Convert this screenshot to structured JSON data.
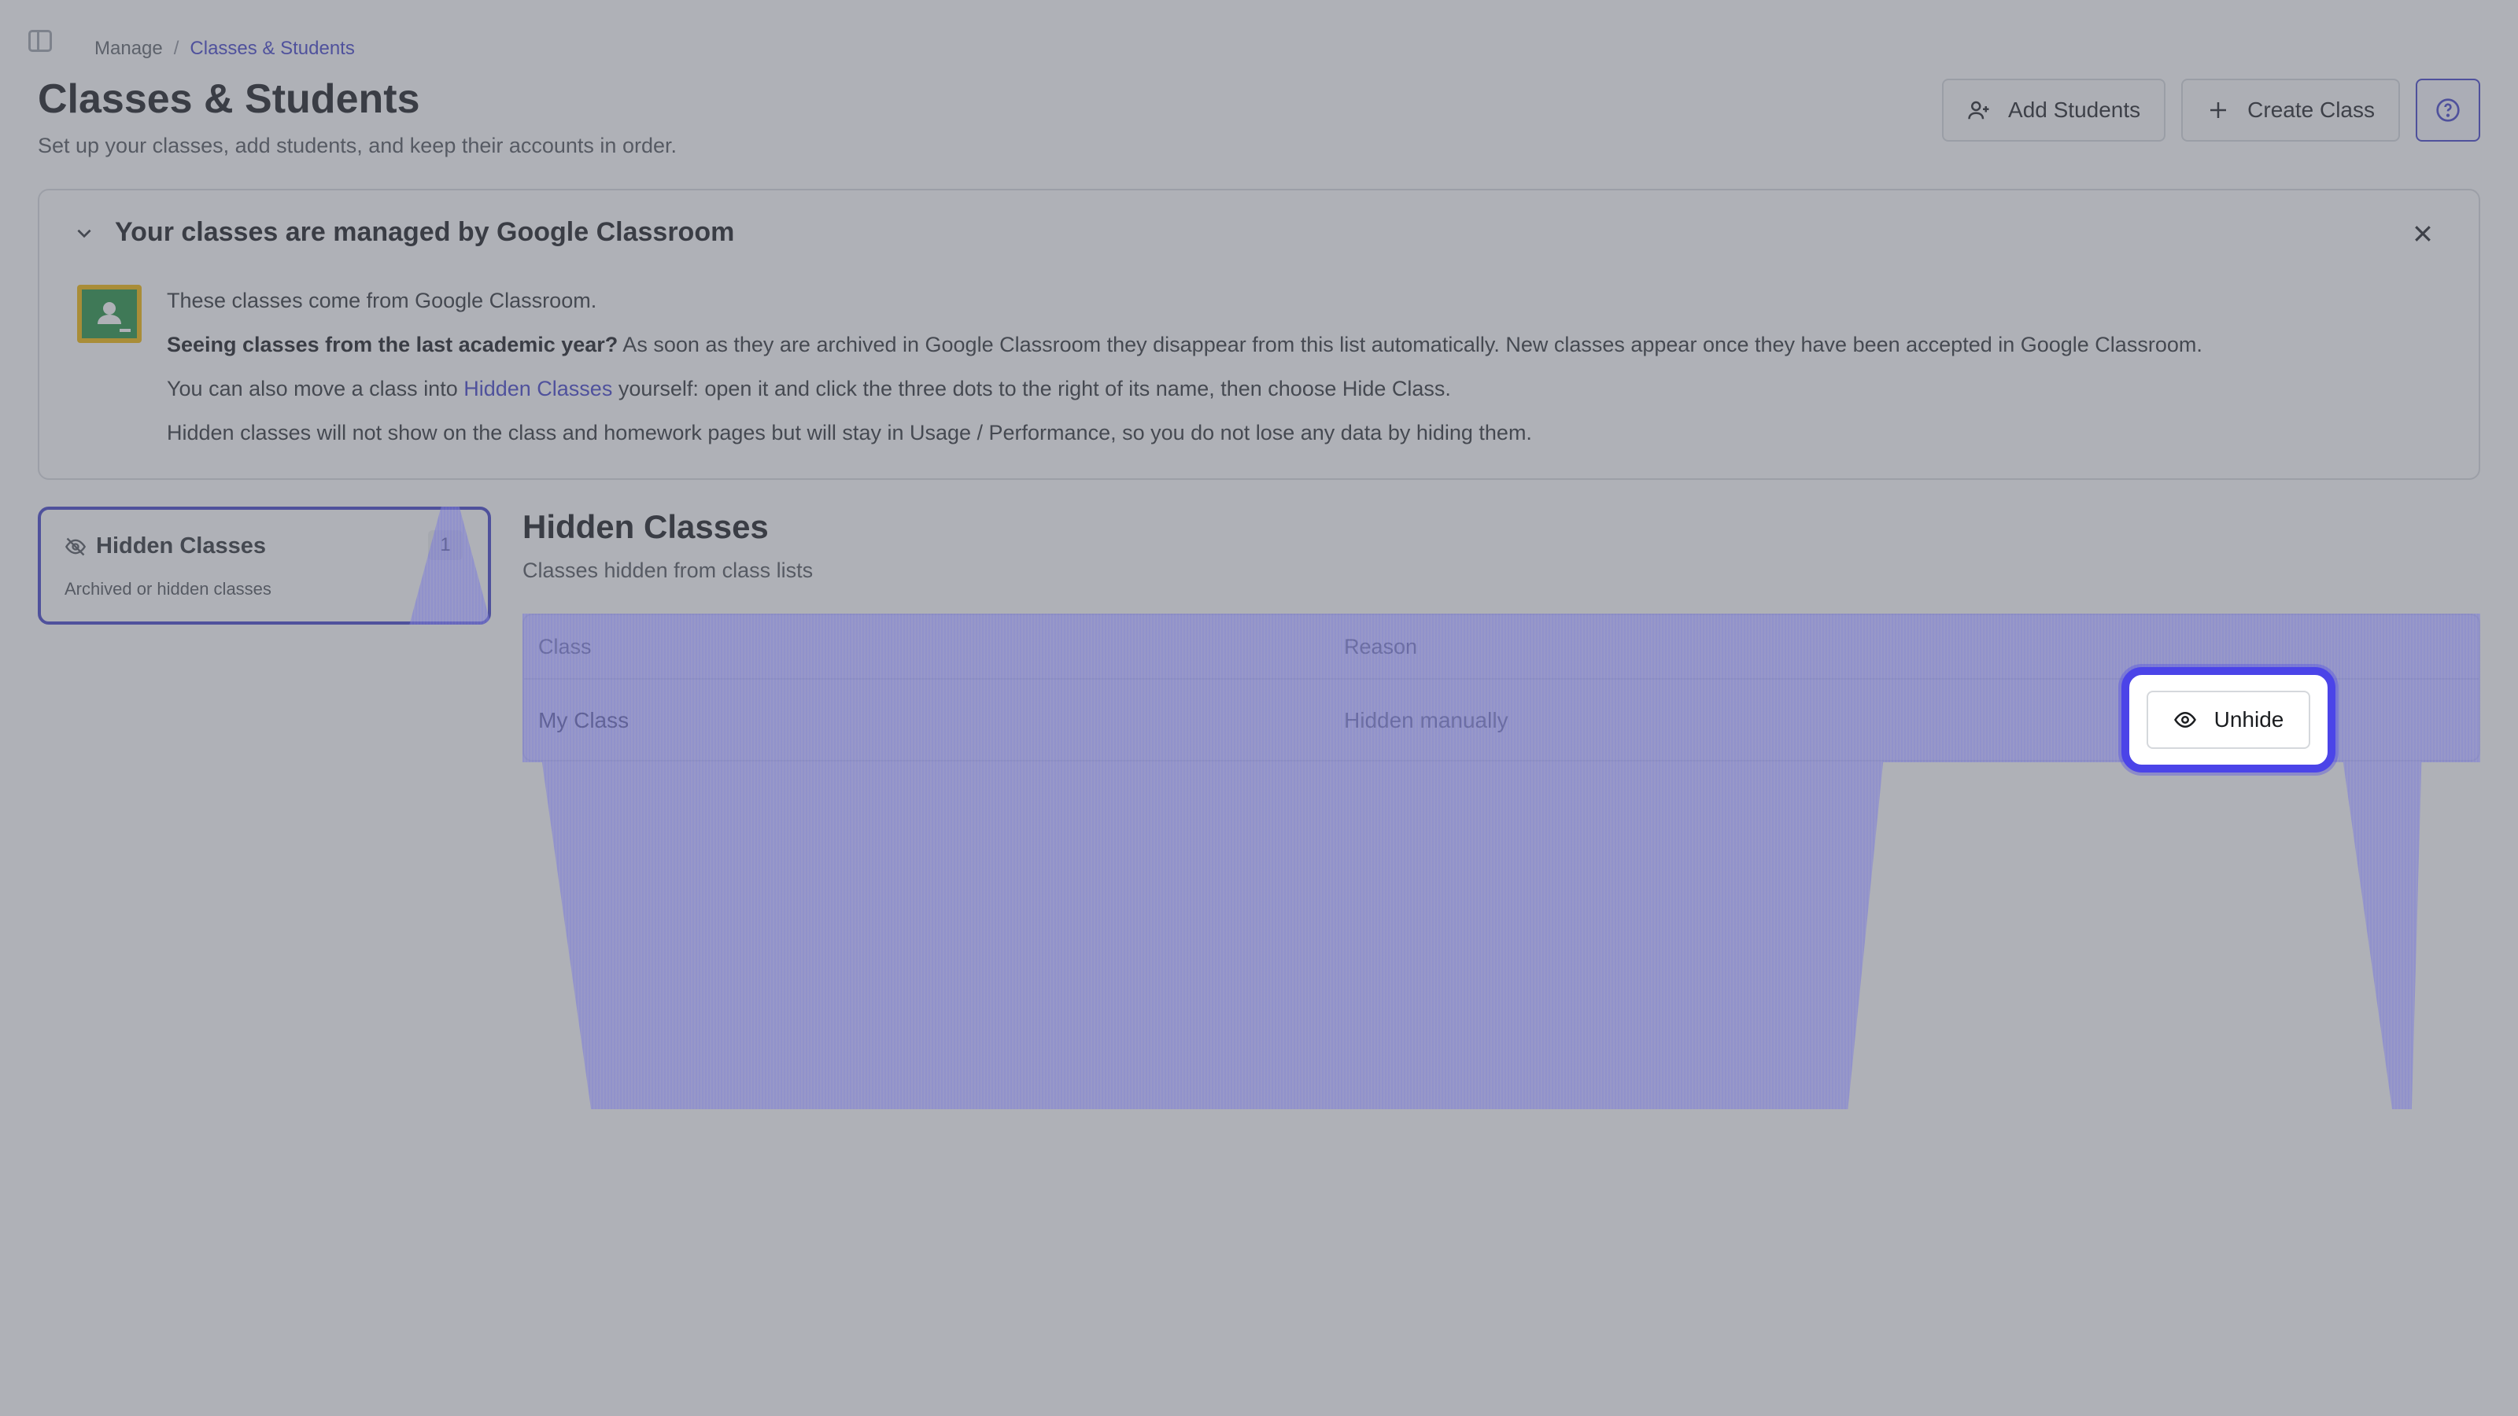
{
  "breadcrumb": {
    "parent": "Manage",
    "separator": "/",
    "current": "Classes & Students"
  },
  "header": {
    "title": "Classes & Students",
    "subtitle": "Set up your classes, add students, and keep their accounts in order.",
    "add_students_label": "Add Students",
    "create_class_label": "Create Class"
  },
  "banner": {
    "title": "Your classes are managed by Google Classroom",
    "line1": "These classes come from Google Classroom.",
    "line2_bold": "Seeing classes from the last academic year?",
    "line2_rest": " As soon as they are archived in Google Classroom they disappear from this list automatically. New classes appear once they have been accepted in Google Classroom.",
    "line3_pre": "You can also move a class into ",
    "line3_link": "Hidden Classes",
    "line3_post": " yourself: open it and click the three dots to the right of its name, then choose Hide Class.",
    "line4": "Hidden classes will not show on the class and homework pages but will stay in Usage / Performance, so you do not lose any data by hiding them."
  },
  "hidden_card": {
    "title": "Hidden Classes",
    "subtitle": "Archived or hidden classes",
    "count": "1"
  },
  "section": {
    "title": "Hidden Classes",
    "subtitle": "Classes hidden from class lists"
  },
  "table": {
    "headers": {
      "class": "Class",
      "reason": "Reason"
    },
    "rows": [
      {
        "class": "My Class",
        "reason": "Hidden manually",
        "action": "Unhide"
      }
    ]
  },
  "colors": {
    "accent": "#3f3fc9",
    "focus": "#4b44e8",
    "overlay": "#5f6470"
  }
}
